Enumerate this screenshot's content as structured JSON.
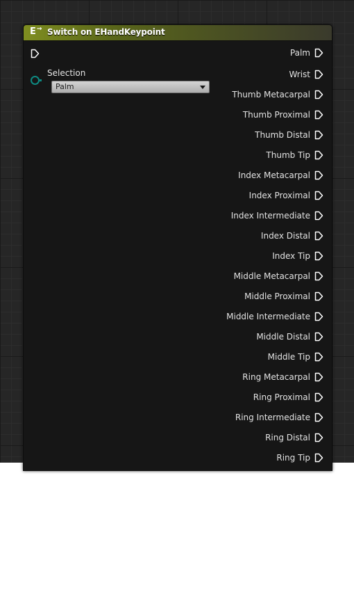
{
  "node": {
    "title": "Switch on EHandKeypoint",
    "icon": "enum-switch-icon",
    "icon_glyph": "E",
    "icon_arrow": "→",
    "header_color": "#7f8e20",
    "selection_label": "Selection",
    "selection_value": "Palm",
    "pin_color": "#0e8a82",
    "outputs": [
      "Palm",
      "Wrist",
      "Thumb Metacarpal",
      "Thumb Proximal",
      "Thumb Distal",
      "Thumb Tip",
      "Index Metacarpal",
      "Index Proximal",
      "Index Intermediate",
      "Index Distal",
      "Index Tip",
      "Middle Metacarpal",
      "Middle Proximal",
      "Middle Intermediate",
      "Middle Distal",
      "Middle Tip",
      "Ring Metacarpal",
      "Ring Proximal",
      "Ring Intermediate",
      "Ring Distal",
      "Ring Tip"
    ]
  }
}
